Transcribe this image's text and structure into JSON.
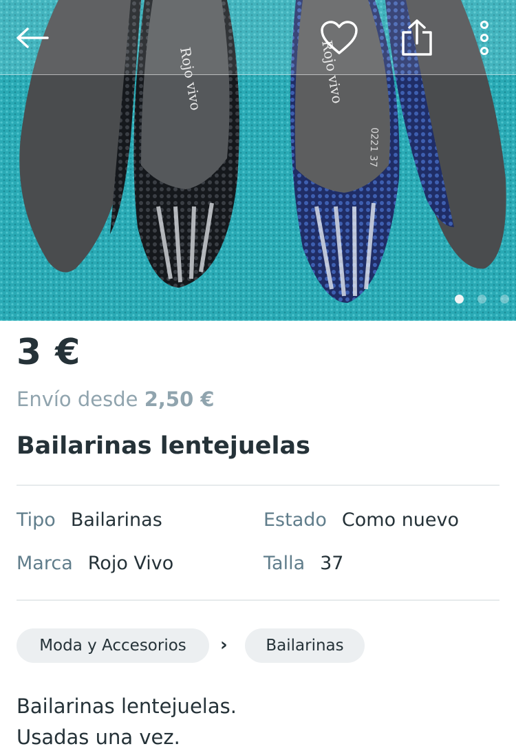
{
  "header": {
    "back_icon": "arrow-left-icon",
    "favorite_icon": "heart-icon",
    "share_icon": "share-icon",
    "more_icon": "more-vertical-icon"
  },
  "gallery": {
    "image_count": 3,
    "active_index": 0,
    "photo_text": {
      "left_brand": "Rojo vivo",
      "right_brand": "Rojo vivo",
      "size_label": "0221 37"
    }
  },
  "listing": {
    "price": "3 €",
    "shipping_prefix": "Envío desde ",
    "shipping_price": "2,50 €",
    "title": "Bailarinas lentejuelas"
  },
  "attributes": {
    "tipo": {
      "label": "Tipo",
      "value": "Bailarinas"
    },
    "estado": {
      "label": "Estado",
      "value": "Como nuevo"
    },
    "marca": {
      "label": "Marca",
      "value": "Rojo Vivo"
    },
    "talla": {
      "label": "Talla",
      "value": "37"
    }
  },
  "breadcrumb": {
    "category": "Moda y Accesorios",
    "separator": "›",
    "subcategory": "Bailarinas"
  },
  "description": {
    "line1": "Bailarinas lentejuelas.",
    "line2": "Usadas una vez."
  },
  "colors": {
    "text": "#253238",
    "muted": "#90a4ae",
    "label": "#607d8b",
    "chip": "#eceff1",
    "towel": "#27a9b4"
  }
}
